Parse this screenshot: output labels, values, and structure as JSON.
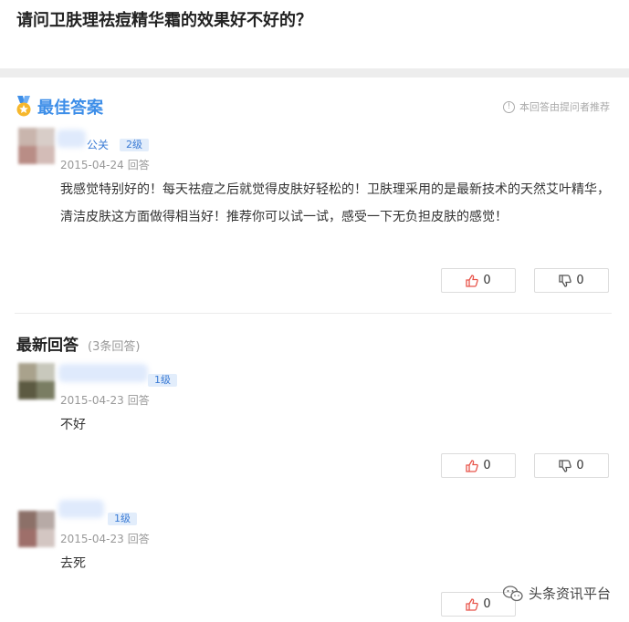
{
  "question": {
    "title": "请问卫肤理祛痘精华霜的效果好不好的？"
  },
  "best_answer": {
    "section_title": "最佳答案",
    "recommend_note": "本回答由提问者推荐",
    "user_name": "公关",
    "level": "2级",
    "date": "2015-04-24",
    "action": "回答",
    "text": "我感觉特别好的！每天祛痘之后就觉得皮肤好轻松的！卫肤理采用的是最新技术的天然艾叶精华，清洁皮肤这方面做得相当好！推荐你可以试一试，感受一下无负担皮肤的感觉！",
    "likes": "0",
    "dislikes": "0"
  },
  "latest": {
    "section_title": "最新回答",
    "count_label": "(3条回答)",
    "answers": [
      {
        "level": "1级",
        "date": "2015-04-23",
        "action": "回答",
        "text": "不好",
        "likes": "0",
        "dislikes": "0"
      },
      {
        "level": "1级",
        "date": "2015-04-23",
        "action": "回答",
        "text": "去死",
        "likes": "0"
      }
    ]
  },
  "watermark": {
    "text": "头条资讯平台"
  },
  "icons": {
    "medal": "medal-icon",
    "info": "info-icon",
    "like": "thumbs-up-icon",
    "dislike": "thumbs-down-icon",
    "watermark": "wechat-icon"
  },
  "colors": {
    "accent": "#3d8ee8",
    "level_badge_bg": "#e2edfb",
    "band": "#ededed"
  }
}
